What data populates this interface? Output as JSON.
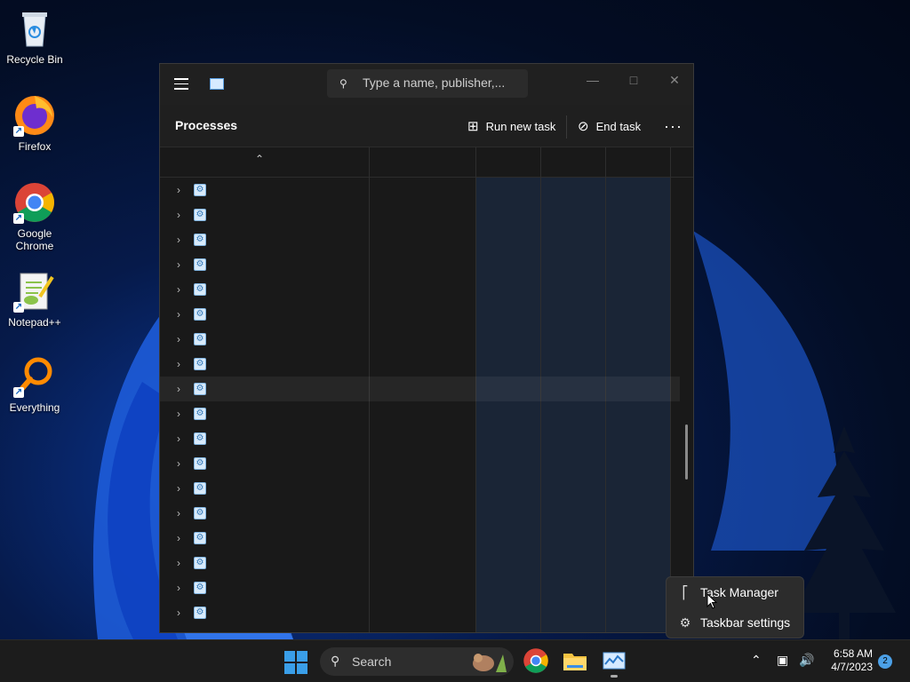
{
  "desktop": {
    "icons": [
      {
        "label": "Recycle Bin",
        "icon": "recycle-bin-icon"
      },
      {
        "label": "Firefox",
        "icon": "firefox-icon"
      },
      {
        "label": "Google Chrome",
        "icon": "chrome-icon"
      },
      {
        "label": "Notepad++",
        "icon": "notepad-plus-plus-icon"
      },
      {
        "label": "Everything",
        "icon": "everything-search-icon"
      }
    ]
  },
  "window": {
    "search_placeholder": "Type a name, publisher,...",
    "page_title": "Processes",
    "run_new_task": "Run new task",
    "end_task": "End task",
    "row_count": 18,
    "highlighted_row": 8
  },
  "context_menu": {
    "items": [
      {
        "label": "Task Manager",
        "icon": "task-manager-icon"
      },
      {
        "label": "Taskbar settings",
        "icon": "gear-icon"
      }
    ]
  },
  "taskbar": {
    "search_label": "Search",
    "pinned": [
      "chrome-icon",
      "file-explorer-icon",
      "task-manager-icon"
    ],
    "time": "6:58 AM",
    "date": "4/7/2023",
    "notification_count": "2"
  },
  "colors": {
    "accent": "#4ca0e6",
    "window_bg": "#1c1c1c",
    "taskbar_bg": "#1c1c1c"
  }
}
